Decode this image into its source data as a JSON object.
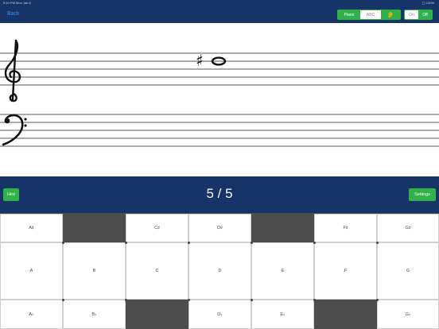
{
  "status": {
    "time": "9:10 PM   Mon Jan 6",
    "battery": "▢ 100%"
  },
  "nav": {
    "back_label": "Back"
  },
  "mode_segment": {
    "piano": "Piano",
    "abc": "ABC",
    "ear": "👂"
  },
  "sound_segment": {
    "on": "On",
    "off": "Off"
  },
  "staff": {
    "accidental": "♯"
  },
  "controls": {
    "hint_label": "Hint",
    "score": "5 / 5",
    "settings_label": "Settings"
  },
  "keyboard": {
    "top_row": [
      "A♯",
      "",
      "C♯",
      "D♯",
      "",
      "F♯",
      "G♯"
    ],
    "middle_row": [
      "A",
      "B",
      "C",
      "D",
      "E",
      "F",
      "G"
    ],
    "bottom_row": [
      "A♭",
      "B♭",
      "",
      "D♭",
      "E♭",
      "",
      "G♭"
    ]
  },
  "colors": {
    "header": "#163468",
    "accent": "#2fb24a",
    "back_link": "#3a8ee6",
    "dark_key": "#4d4d4d"
  }
}
